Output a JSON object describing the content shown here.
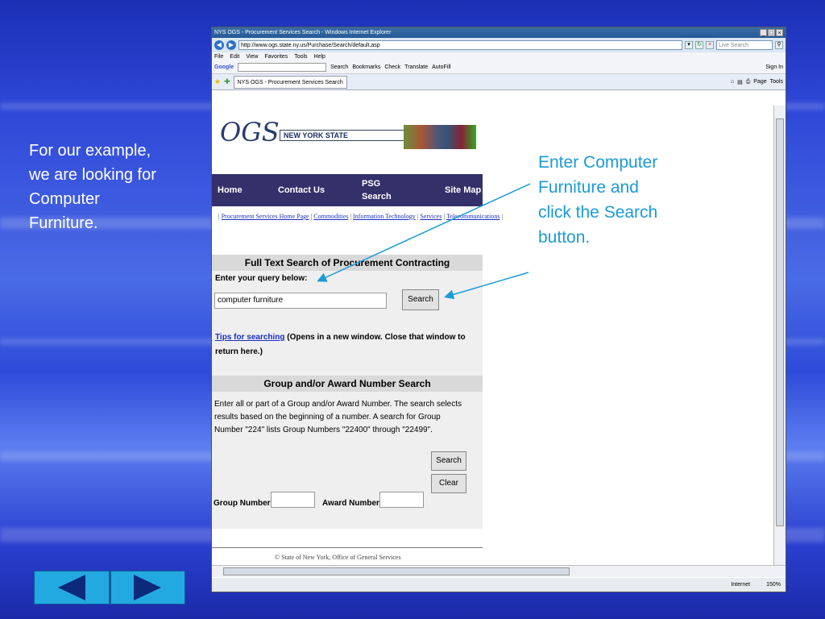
{
  "slide": {
    "left_text": "For our example, we are looking for Computer Furniture.",
    "callout_text": "Enter Computer Furniture and click the Search button."
  },
  "browser": {
    "title": "NYS OGS - Procurement Services Search - Windows Internet Explorer",
    "url": "http://www.ogs.state.ny.us/Purchase/Search/default.asp",
    "live_search_placeholder": "Live Search",
    "menu": [
      "File",
      "Edit",
      "View",
      "Favorites",
      "Tools",
      "Help"
    ],
    "google_label": "Google",
    "google_items": [
      "Search",
      "Bookmarks",
      "Check",
      "Translate",
      "AutoFill"
    ],
    "sign_in": "Sign In",
    "tab_label": "NYS OGS - Procurement Services Search",
    "page_btn": "Page",
    "tools_btn": "Tools",
    "status_zone": "Internet",
    "zoom": "150%"
  },
  "page": {
    "logo": "OGS",
    "state_banner": "NEW YORK STATE",
    "nav": [
      "Home",
      "Contact Us",
      "PSG Search",
      "Site Map"
    ],
    "links": [
      "Procurement Services Home Page",
      "Commodities",
      "Information Technology",
      "Services",
      "Telecommunications"
    ],
    "fulltext_heading": "Full Text Search of Procurement Contracting",
    "query_label": "Enter your query below:",
    "query_value": "computer furniture",
    "search_btn": "Search",
    "tips_link": "Tips for searching",
    "tips_text": " (Opens in a new window. Close that window to return here.)",
    "group_heading": "Group and/or Award Number Search",
    "group_desc": "Enter all or part of a Group and/or Award Number. The search selects results based on the beginning of a number. A search for Group Number \"224\" lists Group Numbers \"22400\" through \"22499\".",
    "search_btn2": "Search",
    "clear_btn": "Clear",
    "group_label": "Group Number:",
    "award_label": "Award Number:",
    "footer": "© State of New York, Office of General Services"
  }
}
